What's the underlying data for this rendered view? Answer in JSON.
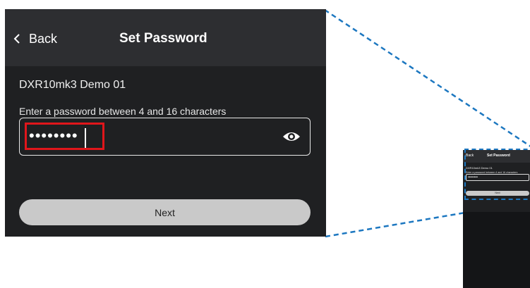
{
  "header": {
    "back_label": "Back",
    "title": "Set Password"
  },
  "main": {
    "device_name": "DXR10mk3 Demo 01",
    "hint": "Enter a password between 4 and 16 characters",
    "password_masked": "••••••••",
    "next_label": "Next"
  },
  "mini": {
    "back_label": "Back",
    "title": "Set Password",
    "device_name": "DXR10mk3 Demo 01",
    "hint": "Enter a password between 4 and 16 characters",
    "password_masked": "••••••••",
    "next_label": "Next"
  },
  "icons": {
    "back": "chevron-left-icon",
    "visibility": "eye-icon"
  },
  "colors": {
    "highlight": "#e0161b",
    "zoom_lines": "#1c77c0",
    "panel_bg": "#1f2022",
    "header_bg": "#2d2e31",
    "button_bg": "#c9c9c9"
  }
}
